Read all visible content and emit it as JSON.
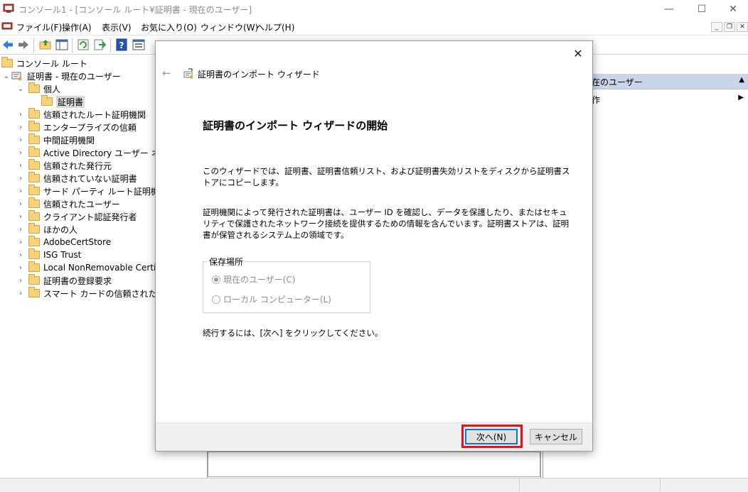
{
  "window": {
    "title": "コンソール1 - [コンソール ルート¥証明書 - 現在のユーザー]",
    "minimize_glyph": "—",
    "maximize_glyph": "☐",
    "close_glyph": "✕"
  },
  "menubar": {
    "items": [
      "ファイル(F)",
      "操作(A)",
      "表示(V)",
      "お気に入り(O)",
      "ウィンドウ(W)",
      "ヘルプ(H)"
    ],
    "mdi_min": "_",
    "mdi_restore": "❐",
    "mdi_close": "✕"
  },
  "toolbar": {
    "icons": [
      "back-arrow-icon",
      "forward-arrow-icon",
      "up-folder-icon",
      "show-hide-tree-icon",
      "refresh-icon",
      "export-list-icon",
      "help-icon",
      "properties-icon"
    ]
  },
  "tree": {
    "root": "コンソール ルート",
    "store": "証明書 - 現在のユーザー",
    "personal": "個人",
    "certificates": "証明書",
    "items": [
      "信頼されたルート証明機関",
      "エンタープライズの信頼",
      "中間証明機関",
      "Active Directory ユーザー オブジェクト",
      "信頼された発行元",
      "信頼されていない証明書",
      "サード パーティ ルート証明機関",
      "信頼されたユーザー",
      "クライアント認証発行者",
      "ほかの人",
      "AdobeCertStore",
      "ISG Trust",
      "Local NonRemovable Certificates",
      "証明書の登録要求",
      "スマート カードの信頼されたルート"
    ]
  },
  "actions": {
    "header": "在のユーザー",
    "sub": "作"
  },
  "dialog": {
    "wizard_title": "証明書のインポート ウィザード",
    "heading": "証明書のインポート ウィザードの開始",
    "para1": "このウィザードでは、証明書、証明書信頼リスト、および証明書失効リストをディスクから証明書ストアにコピーします。",
    "para2": "証明機関によって発行された証明書は、ユーザー ID を確認し、データを保護したり、またはセキュリティで保護されたネットワーク接続を提供するための情報を含んでいます。証明書ストアは、証明書が保管されるシステム上の領域です。",
    "location_label": "保存場所",
    "option_current_user": "現在のユーザー(C)",
    "option_local_machine": "ローカル コンピューター(L)",
    "current_user_selected": true,
    "continue_text": "続行するには、[次へ] をクリックしてください。",
    "next_button": "次へ(N)",
    "cancel_button": "キャンセル"
  },
  "colors": {
    "highlight": "#e8101e",
    "actions_header": "#c9d6e8",
    "primary_border": "#0078d7"
  }
}
